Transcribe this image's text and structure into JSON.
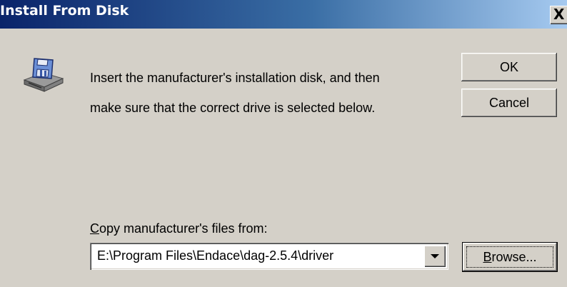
{
  "window": {
    "title": "Install From Disk",
    "close_glyph": "X"
  },
  "icon": {
    "name": "floppy-disk-drive-icon"
  },
  "message": {
    "line1": "Insert the manufacturer's installation disk, and then",
    "line2": "make sure that the correct drive is selected below."
  },
  "buttons": {
    "ok": "OK",
    "cancel": "Cancel",
    "browse_accel": "B",
    "browse_rest": "rowse..."
  },
  "copy_from": {
    "label_accel": "C",
    "label_rest": "opy manufacturer's files from:",
    "value": "E:\\Program Files\\Endace\\dag-2.5.4\\driver"
  },
  "colors": {
    "dialog_bg": "#d4d0c8",
    "title_start": "#0a246a",
    "title_end": "#a6caf0"
  }
}
